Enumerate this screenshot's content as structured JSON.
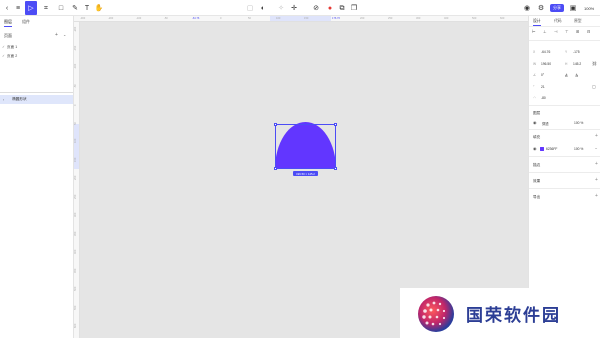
{
  "colors": {
    "accent": "#4c4cf5",
    "shape_fill": "#6236ff",
    "canvas_bg": "#e5e5e5"
  },
  "toolbar": {
    "tools": [
      {
        "name": "back-icon",
        "glyph": "‹"
      },
      {
        "name": "menu-icon",
        "glyph": "≡"
      },
      {
        "name": "move-tool-icon",
        "glyph": "▷"
      },
      {
        "name": "frame-tool-icon",
        "glyph": "⌗"
      },
      {
        "name": "rectangle-tool-icon",
        "glyph": "□"
      },
      {
        "name": "pen-tool-icon",
        "glyph": "✎"
      },
      {
        "name": "text-tool-icon",
        "glyph": "T"
      },
      {
        "name": "hand-tool-icon",
        "glyph": "✋"
      }
    ],
    "center_tools": [
      {
        "name": "boolean-icon",
        "glyph": "▢"
      },
      {
        "name": "mask-icon",
        "glyph": "◐"
      },
      {
        "name": "component-icon",
        "glyph": "✧"
      },
      {
        "name": "crosshair-icon",
        "glyph": "✛"
      },
      {
        "name": "link-icon",
        "glyph": "⊘"
      },
      {
        "name": "fill-color-icon",
        "glyph": "●"
      },
      {
        "name": "duplicate-icon",
        "glyph": "⧉"
      },
      {
        "name": "layers-icon",
        "glyph": "❐"
      }
    ],
    "share_label": "分享",
    "zoom": "100%"
  },
  "left_panel": {
    "tabs": [
      "图层",
      "组件"
    ],
    "section_title": "页面",
    "pages": [
      "页面 1",
      "页面 2"
    ],
    "layer_name": "椭圆形状"
  },
  "rulers": {
    "top_ticks": [
      "-300",
      "-200",
      "-100",
      "-50",
      "-64.76",
      "0",
      "50",
      "100",
      "150",
      "176.76",
      "200",
      "250",
      "300",
      "400",
      "500",
      "600"
    ],
    "left_ticks": [
      "-200",
      "-150",
      "-100",
      "-50",
      "0",
      "50",
      "100",
      "150",
      "200",
      "250",
      "300",
      "350",
      "400",
      "450",
      "500",
      "550",
      "600"
    ]
  },
  "canvas": {
    "shape": "half-ellipse",
    "size_label": "196.50 × 145.2"
  },
  "right_panel": {
    "tabs": [
      "设计",
      "代码",
      "原型"
    ],
    "x_label": "X",
    "x_value": "-64.76",
    "y_label": "Y",
    "y_value": "-175",
    "w_label": "W",
    "w_value": "196.50",
    "h_label": "H",
    "h_value": "145.2",
    "rotation_label": "∠",
    "rotation_value": "0°",
    "radius_label": "⌜",
    "radius_value": "21",
    "extra_value": "-80",
    "layer_section": "图层",
    "layer_mode": "穿透",
    "layer_opacity": "100 %",
    "fill_section": "填充",
    "fill_hex": "6236FF",
    "fill_opacity": "100 %",
    "stroke_section": "描边",
    "effect_section": "效果",
    "export_section": "导出"
  },
  "watermark": {
    "text": "国荣软件园"
  }
}
